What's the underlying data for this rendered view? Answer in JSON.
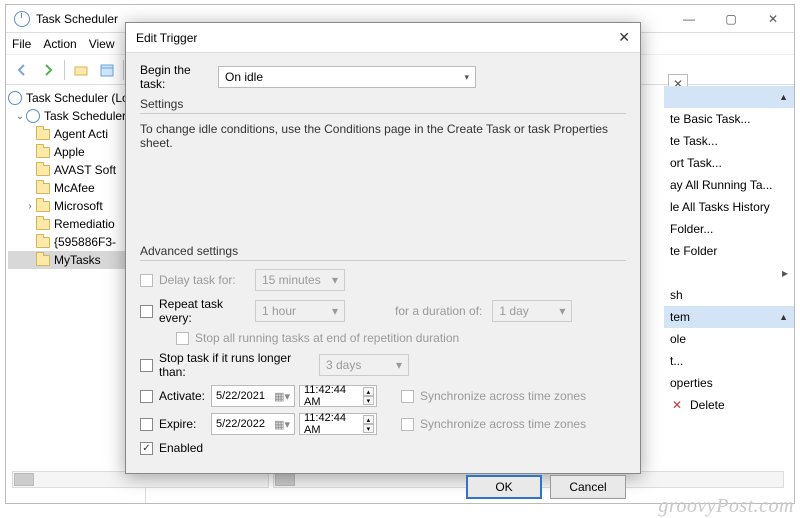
{
  "window": {
    "title": "Task Scheduler",
    "menu": [
      "File",
      "Action",
      "View"
    ]
  },
  "tree": {
    "root": "Task Scheduler (Lo",
    "lib": "Task Scheduler",
    "items": [
      "Agent Acti",
      "Apple",
      "AVAST Soft",
      "McAfee",
      "Microsoft",
      "Remediatio",
      "{595886F3-",
      "MyTasks"
    ]
  },
  "actions": {
    "section1": "",
    "items1": [
      "te Basic Task...",
      "te Task...",
      "ort Task...",
      "ay All Running Ta...",
      "le All Tasks History",
      "Folder...",
      "te Folder"
    ],
    "items2": [
      "sh"
    ],
    "section2": "tem",
    "items3": [
      "ole",
      "t...",
      "operties",
      "Delete"
    ]
  },
  "dialog": {
    "title": "Edit Trigger",
    "begin_label": "Begin the task:",
    "begin_value": "On idle",
    "settings_label": "Settings",
    "hint": "To change idle conditions, use the Conditions page in the Create Task or task Properties sheet.",
    "adv_label": "Advanced settings",
    "delay_label": "Delay task for:",
    "delay_value": "15 minutes",
    "repeat_label": "Repeat task every:",
    "repeat_value": "1 hour",
    "duration_label": "for a duration of:",
    "duration_value": "1 day",
    "stopall_label": "Stop all running tasks at end of repetition duration",
    "stopif_label": "Stop task if it runs longer than:",
    "stopif_value": "3 days",
    "activate_label": "Activate:",
    "activate_date": "5/22/2021",
    "activate_time": "11:42:44 AM",
    "expire_label": "Expire:",
    "expire_date": "5/22/2022",
    "expire_time": "11:42:44 AM",
    "sync_label": "Synchronize across time zones",
    "enabled_label": "Enabled",
    "ok": "OK",
    "cancel": "Cancel"
  },
  "watermark": "groovyPost.com"
}
